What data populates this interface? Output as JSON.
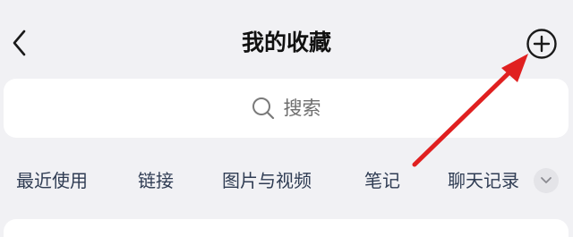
{
  "header": {
    "title": "我的收藏",
    "back_icon": "chevron-left-icon",
    "add_icon": "plus-circle-icon"
  },
  "search": {
    "placeholder": "搜索",
    "icon": "search-icon"
  },
  "tabs": [
    {
      "label": "最近使用"
    },
    {
      "label": "链接"
    },
    {
      "label": "图片与视频"
    },
    {
      "label": "笔记"
    },
    {
      "label": "聊天记录"
    }
  ],
  "tabs_more_icon": "chevron-down-icon",
  "annotation": {
    "arrow_color": "#e02020"
  },
  "colors": {
    "background": "#f1f1f4",
    "card": "#ffffff",
    "tab_text": "#2f3c53"
  }
}
